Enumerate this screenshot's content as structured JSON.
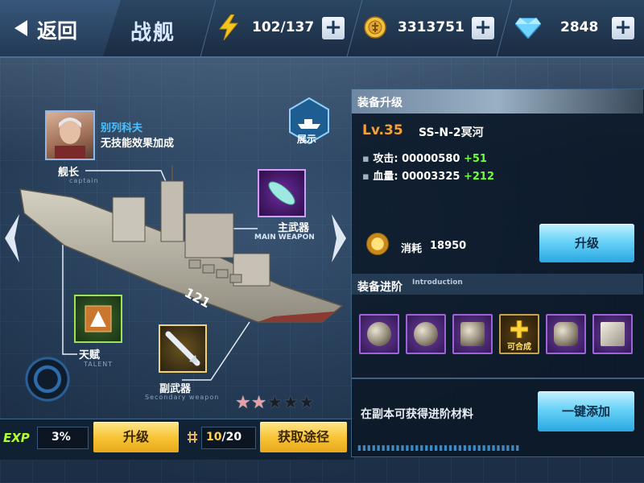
{
  "header": {
    "back_label": "返回",
    "title": "战舰",
    "energy": "102/137",
    "gold": "3313751",
    "diamonds": "2848"
  },
  "left": {
    "captain_name": "别列科夫",
    "captain_desc": "无技能效果加成",
    "captain_tag": "舰长",
    "captain_tag_sub": "captain",
    "show_label": "展示",
    "main_weapon_label": "主武器",
    "main_weapon_sub": "MAIN WEAPON",
    "talent_label": "天赋",
    "talent_sub": "TALENT",
    "secondary_label": "副武器",
    "secondary_sub": "Secondary weapon",
    "hull_number": "121",
    "stars_filled": 2,
    "stars_total": 5
  },
  "bottom": {
    "exp_label": "EXP",
    "exp_value": "3%",
    "upgrade_label": "升级",
    "count_current": "10",
    "count_total": "/20",
    "get_path_label": "获取途径"
  },
  "equip": {
    "panel_title": "装备升级",
    "level": "Lv.35",
    "weapon_name": "SS-N-2冥河",
    "attack_label": "攻击: ",
    "attack_value": "00000580",
    "attack_bonus": "+51",
    "hp_label": "血量: ",
    "hp_value": "00003325",
    "hp_bonus": "+212",
    "cost_label": "消耗",
    "cost_value": "18950",
    "upgrade_label": "升级"
  },
  "advance": {
    "title": "装备进阶",
    "subtitle": "Introduction",
    "craftable_label": "可合成",
    "hint": "在副本可获得进阶材料",
    "auto_add_label": "一键添加"
  },
  "colors": {
    "accent_blue": "#4ac2ff",
    "level_orange": "#f3a233",
    "bonus_green": "#6dff3a",
    "exp_green": "#b3ff2e",
    "star_filled": "#e8a0a8",
    "star_empty": "#1a1f26"
  }
}
